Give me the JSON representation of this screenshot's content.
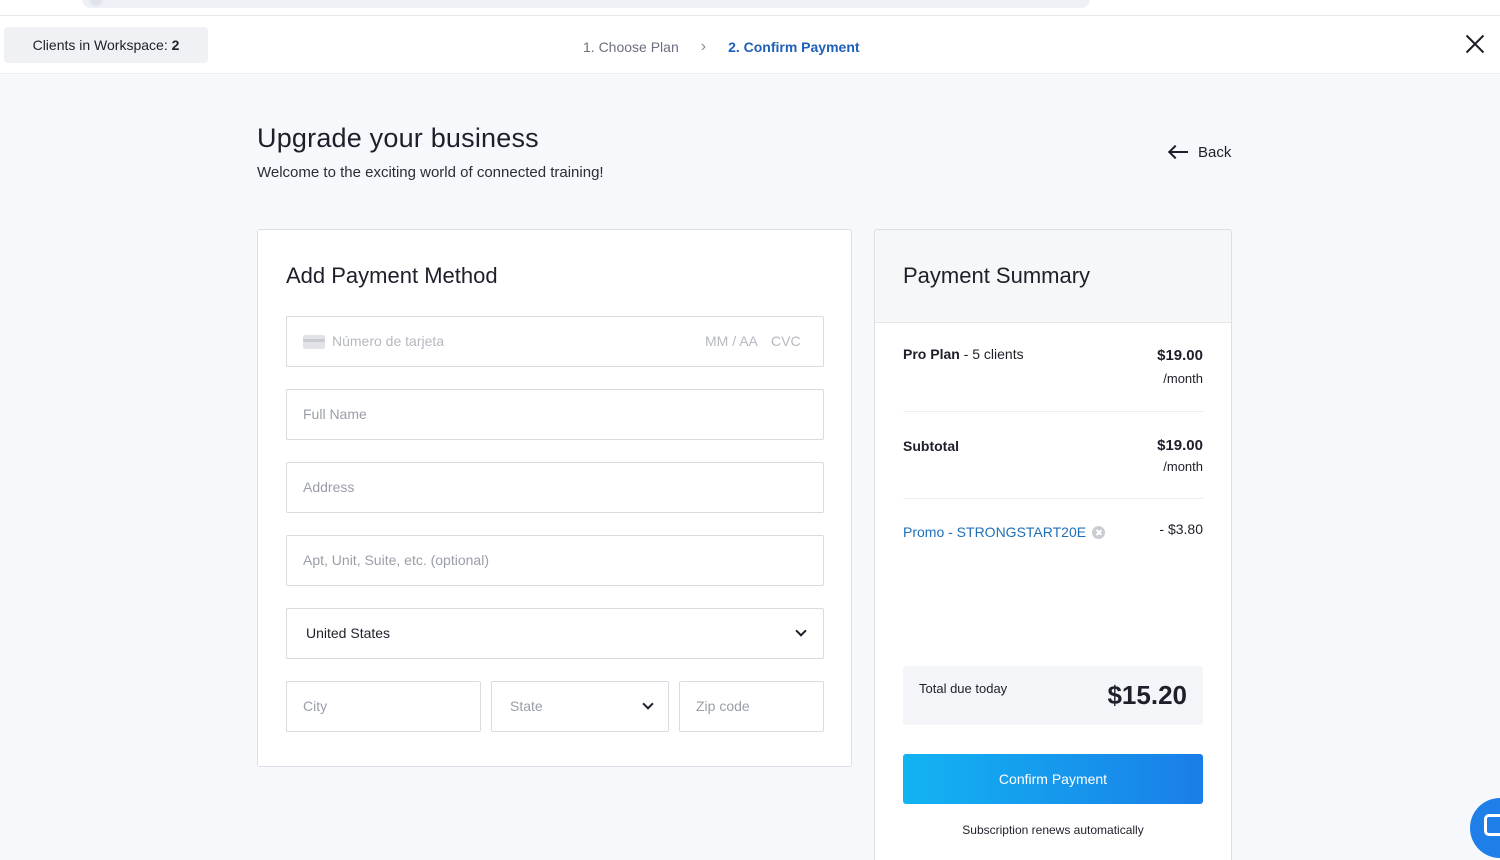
{
  "header": {
    "clients_label": "Clients in Workspace:",
    "clients_count": "2",
    "steps": [
      {
        "label": "1. Choose Plan",
        "active": false
      },
      {
        "label": "2. Confirm Payment",
        "active": true
      }
    ],
    "step_separator": "›"
  },
  "page": {
    "title": "Upgrade your business",
    "subtitle": "Welcome to the exciting world of connected training!",
    "back_label": "Back"
  },
  "payment_method": {
    "title": "Add Payment Method",
    "card_number_placeholder": "Número de tarjeta",
    "card_expiry_placeholder": "MM / AA",
    "card_cvc_placeholder": "CVC",
    "full_name_placeholder": "Full Name",
    "address_placeholder": "Address",
    "apt_placeholder": "Apt, Unit, Suite, etc. (optional)",
    "country_value": "United States",
    "city_placeholder": "City",
    "state_placeholder": "State",
    "zip_placeholder": "Zip code"
  },
  "summary": {
    "title": "Payment Summary",
    "plan_name": "Pro Plan",
    "plan_detail": "- 5 clients",
    "plan_price": "$19.00",
    "plan_period": "/month",
    "subtotal_label": "Subtotal",
    "subtotal_price": "$19.00",
    "subtotal_period": "/month",
    "promo_label": "Promo - STRONGSTART20E",
    "promo_discount": "- $3.80",
    "total_label": "Total due today",
    "total_amount": "$15.20",
    "confirm_label": "Confirm Payment",
    "renew_note": "Subscription renews automatically"
  },
  "colors": {
    "accent": "#1f5fb8",
    "button_start": "#12b4f2",
    "button_end": "#1a7ee8",
    "promo": "#1f6fb8"
  }
}
